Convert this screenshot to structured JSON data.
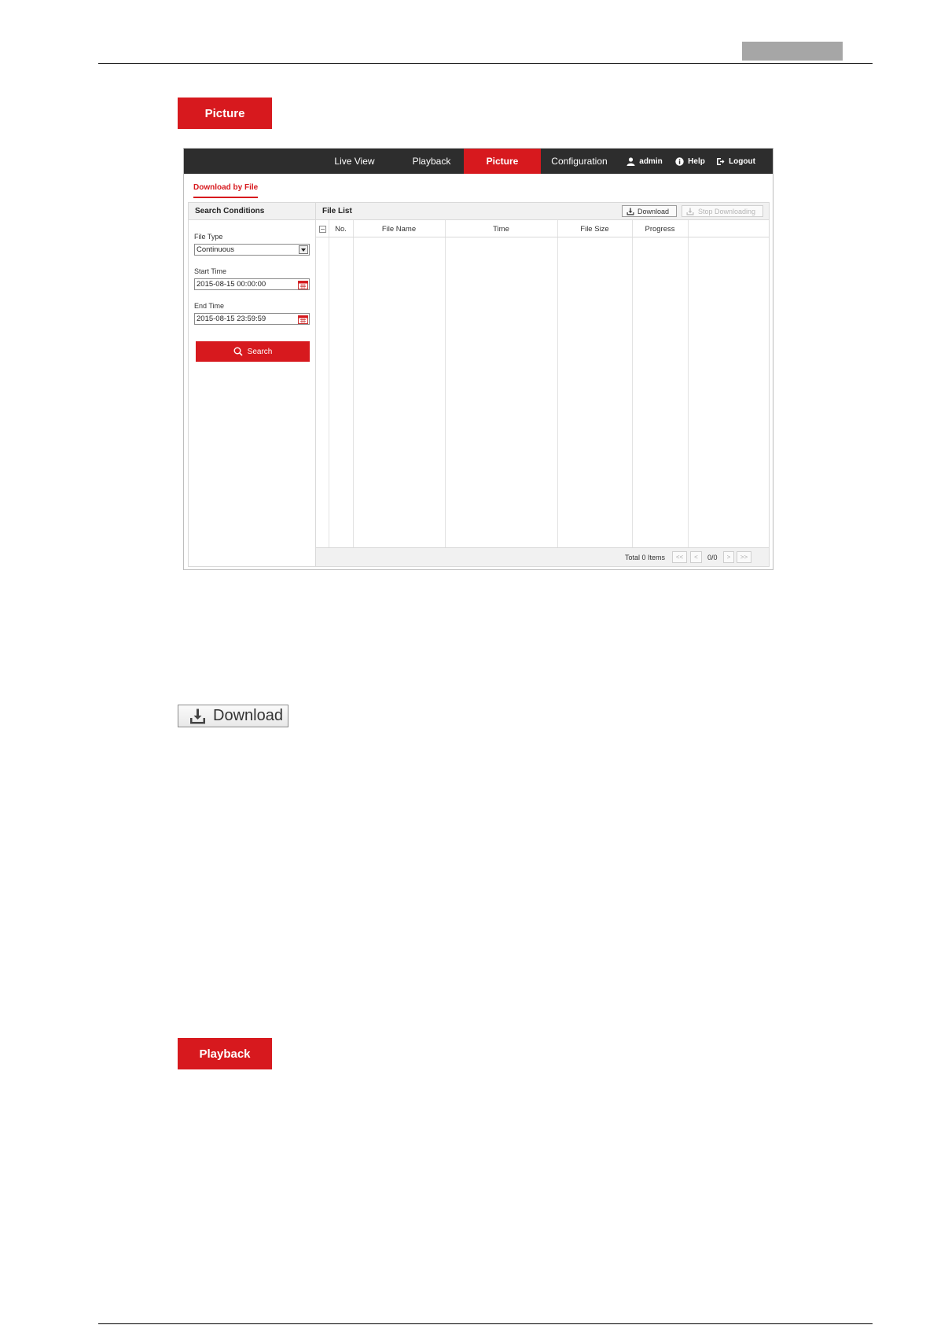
{
  "document": {
    "label_picture": "Picture",
    "label_playback": "Playback",
    "download_illustration": "Download"
  },
  "app": {
    "nav": {
      "live_view": "Live View",
      "playback": "Playback",
      "picture": "Picture",
      "configuration": "Configuration",
      "user": "admin",
      "help": "Help",
      "logout": "Logout"
    },
    "active_tab": "Picture",
    "sub_tab": "Download by File",
    "search_panel": {
      "title": "Search Conditions",
      "file_type_label": "File Type",
      "file_type_value": "Continuous",
      "start_time_label": "Start Time",
      "start_time_value": "2015-08-15 00:00:00",
      "end_time_label": "End Time",
      "end_time_value": "2015-08-15 23:59:59",
      "search_button": "Search"
    },
    "file_list": {
      "title": "File List",
      "download_button": "Download",
      "stop_button": "Stop Downloading",
      "columns": [
        "No.",
        "File Name",
        "Time",
        "File Size",
        "Progress"
      ],
      "rows": [],
      "total_text": "Total 0 Items",
      "pager": {
        "first": "<<",
        "prev": "<",
        "page": "0/0",
        "next": ">",
        "last": ">>"
      }
    },
    "colors": {
      "accent": "#d7191e",
      "topbar": "#2d2d2d"
    }
  },
  "icons": [
    "user-icon",
    "help-icon",
    "logout-icon",
    "download-icon",
    "calendar-icon",
    "search-icon"
  ]
}
